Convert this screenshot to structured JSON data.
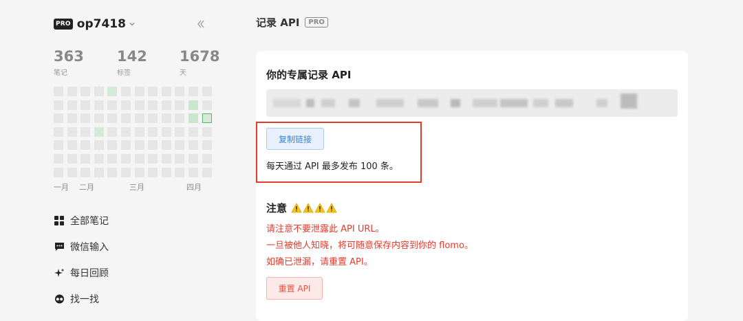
{
  "sidebar": {
    "pro_badge": "PRO",
    "username": "op7418",
    "stats": [
      {
        "value": "363",
        "label": "笔记"
      },
      {
        "value": "142",
        "label": "标签"
      },
      {
        "value": "1678",
        "label": "天"
      }
    ],
    "months": [
      "一月",
      "二月",
      "三月",
      "四月"
    ],
    "nav": [
      {
        "label": "全部笔记",
        "icon": "grid-icon"
      },
      {
        "label": "微信输入",
        "icon": "chat-icon"
      },
      {
        "label": "每日回顾",
        "icon": "sparkle-icon"
      },
      {
        "label": "找一找",
        "icon": "glasses-icon"
      }
    ]
  },
  "main": {
    "title": "记录 API",
    "pro_badge": "PRO",
    "card_heading": "你的专属记录 API",
    "copy_button": "复制链接",
    "limit_text": "每天通过 API 最多发布 100 条。",
    "notice_title": "注意",
    "notice_lines": [
      "请注意不要泄露此 API URL。",
      "一旦被他人知晓，将可随意保存内容到你的 flomo。",
      "如确已泄漏，请重置 API。"
    ],
    "reset_button": "重置 API"
  },
  "colors": {
    "accent_blue": "#3b82d6",
    "warning_red": "#e53b2c",
    "heat_green": "#d6ead8"
  }
}
